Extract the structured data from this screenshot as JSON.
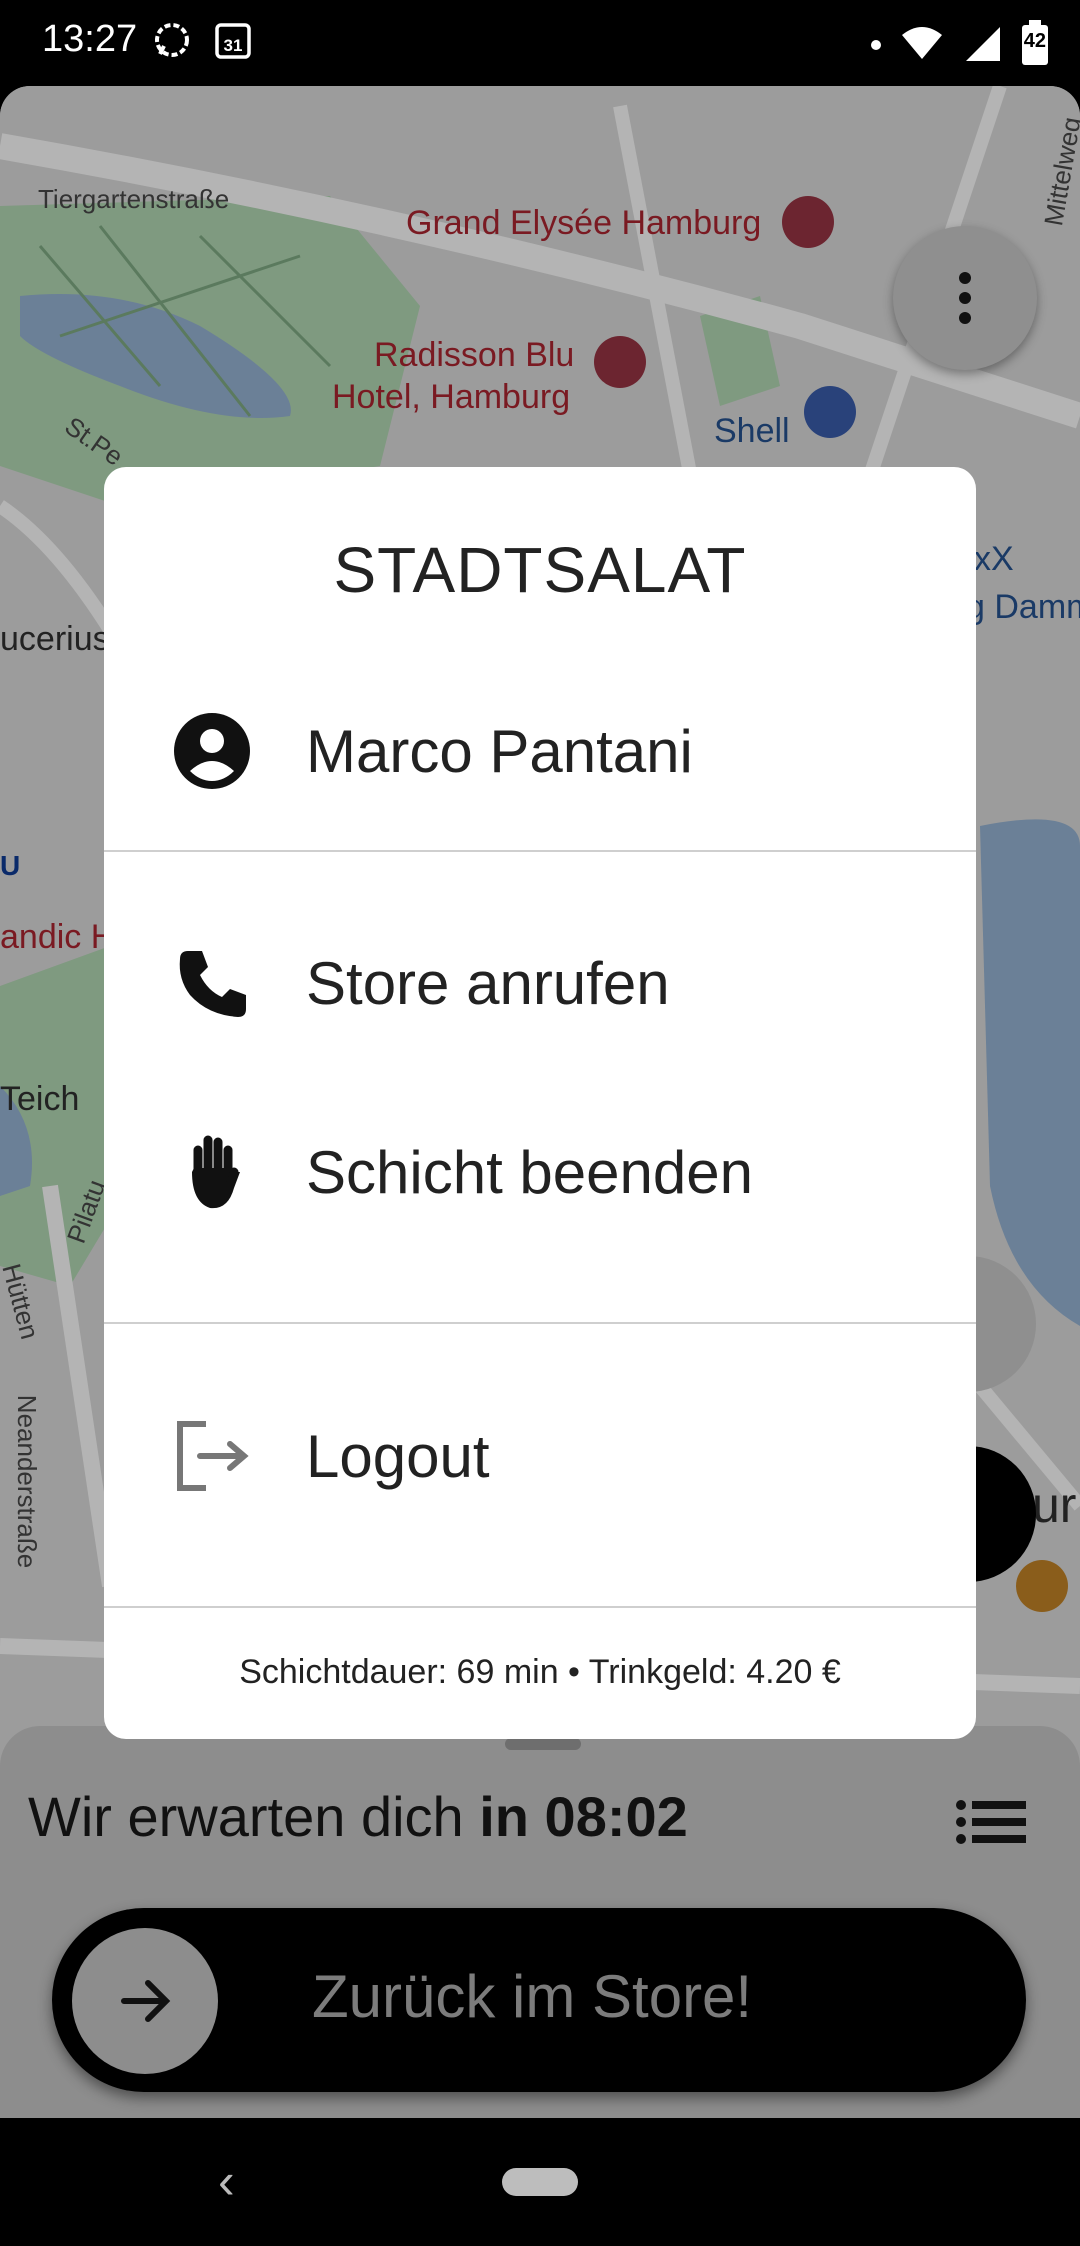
{
  "status_bar": {
    "time": "13:27",
    "calendar_day": "31",
    "battery_level": "42"
  },
  "map": {
    "labels": [
      "Tiergartenstraße",
      "Grand Elysée Hamburg",
      "Radisson Blu",
      "Hotel, Hamburg",
      "Shell",
      "St.Pe",
      "ucerius",
      "andic H",
      "Teich",
      "Pilatu",
      "Hütten",
      "Neanderstraße",
      "Mittelweg",
      "xX",
      "g Damm",
      "ur",
      "U"
    ]
  },
  "dialog": {
    "title": "STADTSALAT",
    "user_name": "Marco Pantani",
    "call_store": "Store anrufen",
    "end_shift": "Schicht beenden",
    "logout": "Logout",
    "footer": "Schichtdauer: 69 min • Trinkgeld: 4.20 €"
  },
  "sheet": {
    "wait_prefix": "Wir erwarten dich ",
    "wait_time": "in 08:02",
    "store_button_label": "Zurück im Store!"
  },
  "colors": {
    "dialog_bg": "#ffffff",
    "overlay": "#000000",
    "button_bg": "#000000"
  }
}
